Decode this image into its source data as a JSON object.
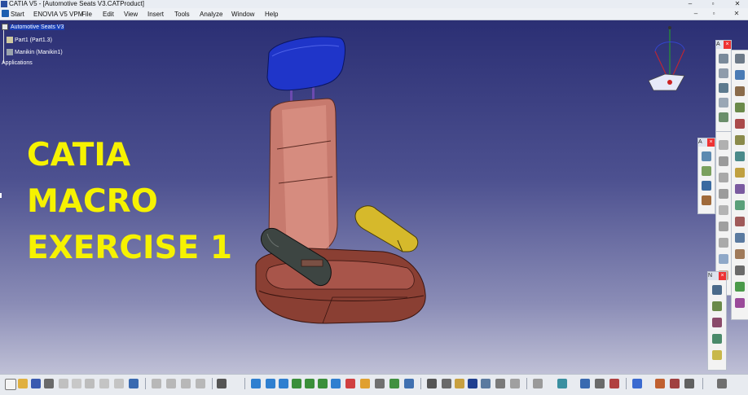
{
  "window": {
    "title": "CATIA V5 - [Automotive Seats V3.CATProduct]",
    "controls": [
      "‒",
      "▫",
      "✕"
    ]
  },
  "menu": {
    "items": [
      "Start",
      "ENOVIA V5 VPM",
      "File",
      "Edit",
      "View",
      "Insert",
      "Tools",
      "Analyze",
      "Window",
      "Help"
    ],
    "doc_controls": [
      "‒",
      "▫",
      "✕"
    ]
  },
  "tree": {
    "root": "Automotive Seats V3",
    "children": [
      "Part1 (Part1.3)",
      "Manikin (Manikin1)"
    ],
    "applications": "Applications"
  },
  "overlay": {
    "line1": "CATIA",
    "line2": "MACRO",
    "line3": "EXERCISE  1"
  },
  "toolbars": {
    "right_top_head": "A",
    "right_mid_head": "A",
    "right_low_head": "N",
    "close_glyph": "×"
  },
  "colors": {
    "headrest": "#1f35c9",
    "seat": "#c77a6e",
    "cushion": "#8a3f33",
    "armrest_right": "#d6b92b",
    "armrest_left": "#3d4542",
    "overlay_text": "#f6f200"
  },
  "icons": {
    "bottom": [
      "new-icon",
      "open-icon",
      "save-icon",
      "print-icon",
      "cut-icon",
      "copy-icon",
      "paste-icon",
      "undo-icon",
      "redo-icon",
      "whatsthis-icon",
      "pan-icon",
      "rotate-icon",
      "fly-icon",
      "select-icon",
      "fit-all-icon",
      "pan-view-icon",
      "rotate-view-icon",
      "zoom-in-icon",
      "zoom-out-icon",
      "normal-view-icon",
      "multi-view-icon",
      "iso-view-icon",
      "shading-icon",
      "hide-show-icon",
      "swap-icon",
      "formula-icon",
      "comment-icon",
      "measure-icon",
      "product-icon",
      "catalog-icon",
      "sphere-icon",
      "reset-icon",
      "compass-icon",
      "snap-icon",
      "manipulate-icon",
      "explode-icon",
      "clash-icon",
      "section-icon",
      "render-icon",
      "material-icon",
      "light-icon",
      "graph-icon"
    ]
  }
}
